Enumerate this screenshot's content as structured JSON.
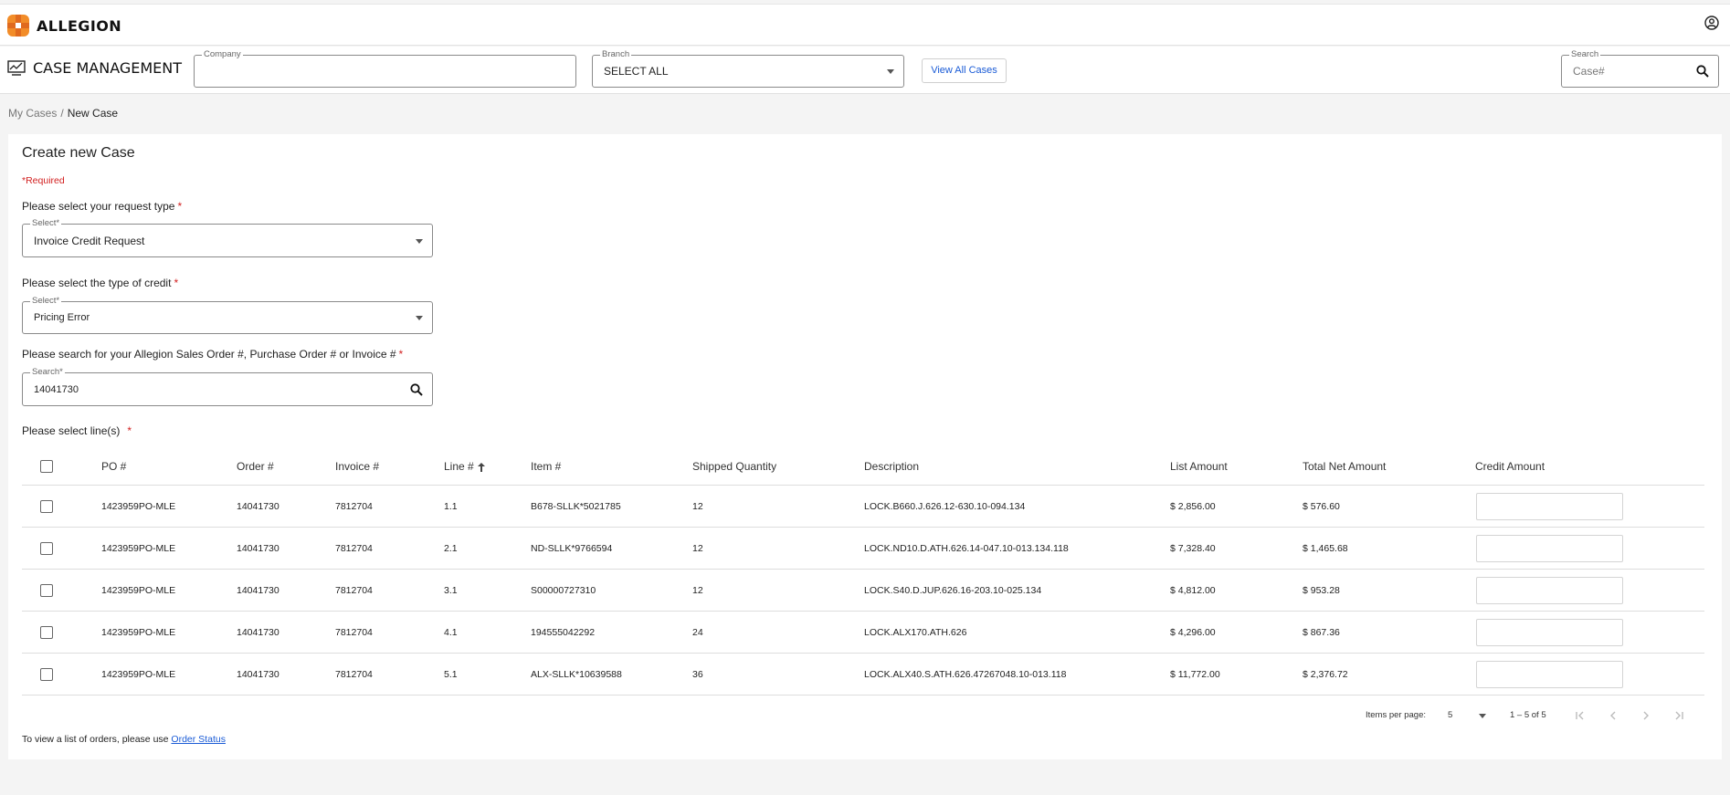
{
  "brand": {
    "name": "ALLEGION",
    "orange": "#f28c28",
    "dark_orange": "#e06a1e"
  },
  "app": {
    "title": "CASE MANAGEMENT",
    "icon": "monitor-chart-icon"
  },
  "header": {
    "company": {
      "label": "Company",
      "value": ""
    },
    "branch": {
      "label": "Branch",
      "value": "SELECT ALL"
    },
    "view_all_label": "View All Cases",
    "search": {
      "label": "Search",
      "placeholder": "Case#"
    }
  },
  "breadcrumb": {
    "parent": "My Cases",
    "separator": "/",
    "current": "New Case"
  },
  "form": {
    "title": "Create new Case",
    "required_note": "*Required",
    "request_type": {
      "question": "Please select your request type",
      "star": "*",
      "label": "Select*",
      "value": "Invoice Credit Request"
    },
    "credit_type": {
      "question": "Please select the type of credit",
      "star": "*",
      "label": "Select*",
      "value": "Pricing Error"
    },
    "order_search": {
      "question": "Please search for your Allegion Sales Order #, Purchase Order # or Invoice #",
      "star": "*",
      "label": "Search*",
      "value": "14041730"
    },
    "lines_question": "Please select line(s)",
    "lines_star": "*"
  },
  "table": {
    "columns": [
      "PO #",
      "Order #",
      "Invoice #",
      "Line #",
      "Item #",
      "Shipped Quantity",
      "Description",
      "List Amount",
      "Total Net Amount",
      "Credit Amount"
    ],
    "rows": [
      {
        "po": "1423959PO-MLE",
        "order": "14041730",
        "invoice": "7812704",
        "line": "1.1",
        "item": "B678-SLLK*5021785",
        "qty": "12",
        "desc": "LOCK.B660.J.626.12-630.10-094.134",
        "list": "$ 2,856.00",
        "net": "$ 576.60",
        "credit": ""
      },
      {
        "po": "1423959PO-MLE",
        "order": "14041730",
        "invoice": "7812704",
        "line": "2.1",
        "item": "ND-SLLK*9766594",
        "qty": "12",
        "desc": "LOCK.ND10.D.ATH.626.14-047.10-013.134.118",
        "list": "$ 7,328.40",
        "net": "$ 1,465.68",
        "credit": ""
      },
      {
        "po": "1423959PO-MLE",
        "order": "14041730",
        "invoice": "7812704",
        "line": "3.1",
        "item": "S00000727310",
        "qty": "12",
        "desc": "LOCK.S40.D.JUP.626.16-203.10-025.134",
        "list": "$ 4,812.00",
        "net": "$ 953.28",
        "credit": ""
      },
      {
        "po": "1423959PO-MLE",
        "order": "14041730",
        "invoice": "7812704",
        "line": "4.1",
        "item": "194555042292",
        "qty": "24",
        "desc": "LOCK.ALX170.ATH.626",
        "list": "$ 4,296.00",
        "net": "$ 867.36",
        "credit": ""
      },
      {
        "po": "1423959PO-MLE",
        "order": "14041730",
        "invoice": "7812704",
        "line": "5.1",
        "item": "ALX-SLLK*10639588",
        "qty": "36",
        "desc": "LOCK.ALX40.S.ATH.626.47267048.10-013.118",
        "list": "$ 11,772.00",
        "net": "$ 2,376.72",
        "credit": ""
      }
    ]
  },
  "pagination": {
    "items_per_page_label": "Items per page:",
    "items_per_page": "5",
    "range": "1 – 5 of 5"
  },
  "footer": {
    "text": "To view a list of orders, please use",
    "link": "Order Status"
  }
}
